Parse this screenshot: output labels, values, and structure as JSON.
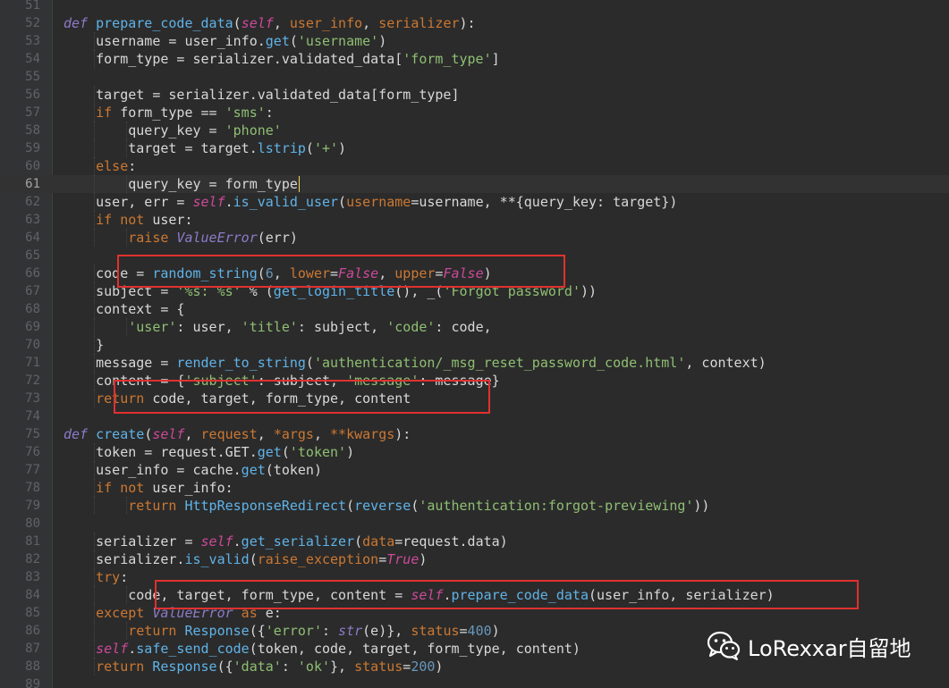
{
  "editor": {
    "language": "python",
    "current_line": 61,
    "colors": {
      "background": "#2b2b2b",
      "keyword": "#cc7832",
      "function": "#5fb3e8",
      "string": "#8fbf73",
      "number": "#6897bb",
      "self": "#cc4a9b",
      "def": "#8d7bc9",
      "highlight_box": "#e0312f"
    },
    "lines": [
      {
        "n": "51",
        "indent": 0,
        "tokens": []
      },
      {
        "n": "52",
        "indent": 1,
        "tokens": [
          [
            "def",
            "def"
          ],
          [
            "t",
            " "
          ],
          [
            "fn",
            "prepare_code_data"
          ],
          [
            "t",
            "("
          ],
          [
            "self",
            "self"
          ],
          [
            "t",
            ", "
          ],
          [
            "kwa",
            "user_info"
          ],
          [
            "t",
            ", "
          ],
          [
            "kwa",
            "serializer"
          ],
          [
            "t",
            "):"
          ]
        ]
      },
      {
        "n": "53",
        "indent": 2,
        "tokens": [
          [
            "t",
            "username = user_info."
          ],
          [
            "fn",
            "get"
          ],
          [
            "t",
            "("
          ],
          [
            "str",
            "'username'"
          ],
          [
            "t",
            ")"
          ]
        ]
      },
      {
        "n": "54",
        "indent": 2,
        "tokens": [
          [
            "t",
            "form_type = serializer.validated_data["
          ],
          [
            "str",
            "'form_type'"
          ],
          [
            "t",
            "]"
          ]
        ]
      },
      {
        "n": "55",
        "indent": 0,
        "tokens": []
      },
      {
        "n": "56",
        "indent": 2,
        "tokens": [
          [
            "t",
            "target = serializer.validated_data[form_type]"
          ]
        ]
      },
      {
        "n": "57",
        "indent": 2,
        "tokens": [
          [
            "kw",
            "if"
          ],
          [
            "t",
            " form_type == "
          ],
          [
            "str",
            "'sms'"
          ],
          [
            "t",
            ":"
          ]
        ]
      },
      {
        "n": "58",
        "indent": 3,
        "tokens": [
          [
            "t",
            "query_key = "
          ],
          [
            "str",
            "'phone'"
          ]
        ]
      },
      {
        "n": "59",
        "indent": 3,
        "tokens": [
          [
            "t",
            "target = target."
          ],
          [
            "fn",
            "lstrip"
          ],
          [
            "t",
            "("
          ],
          [
            "str",
            "'+'"
          ],
          [
            "t",
            ")"
          ]
        ]
      },
      {
        "n": "60",
        "indent": 2,
        "tokens": [
          [
            "kw",
            "else"
          ],
          [
            "t",
            ":"
          ]
        ]
      },
      {
        "n": "61",
        "indent": 3,
        "tokens": [
          [
            "t",
            "query_key = form_type"
          ]
        ]
      },
      {
        "n": "62",
        "indent": 2,
        "tokens": [
          [
            "t",
            "user, err = "
          ],
          [
            "self",
            "self"
          ],
          [
            "t",
            "."
          ],
          [
            "fn",
            "is_valid_user"
          ],
          [
            "t",
            "("
          ],
          [
            "kwa",
            "username"
          ],
          [
            "t",
            "=username, **{query_key: target})"
          ]
        ]
      },
      {
        "n": "63",
        "indent": 2,
        "tokens": [
          [
            "kw",
            "if not"
          ],
          [
            "t",
            " user:"
          ]
        ]
      },
      {
        "n": "64",
        "indent": 3,
        "tokens": [
          [
            "kw",
            "raise"
          ],
          [
            "t",
            " "
          ],
          [
            "cls",
            "ValueError"
          ],
          [
            "t",
            "(err)"
          ]
        ]
      },
      {
        "n": "65",
        "indent": 0,
        "tokens": []
      },
      {
        "n": "66",
        "indent": 2,
        "tokens": [
          [
            "t",
            "code = "
          ],
          [
            "fn",
            "random_string"
          ],
          [
            "t",
            "("
          ],
          [
            "num",
            "6"
          ],
          [
            "t",
            ", "
          ],
          [
            "kwa",
            "lower"
          ],
          [
            "t",
            "="
          ],
          [
            "bool",
            "False"
          ],
          [
            "t",
            ", "
          ],
          [
            "kwa",
            "upper"
          ],
          [
            "t",
            "="
          ],
          [
            "bool",
            "False"
          ],
          [
            "t",
            ")"
          ]
        ]
      },
      {
        "n": "67",
        "indent": 2,
        "tokens": [
          [
            "t",
            "subject = "
          ],
          [
            "str",
            "'%s: %s'"
          ],
          [
            "t",
            " % ("
          ],
          [
            "fn",
            "get_login_title"
          ],
          [
            "t",
            "(), _("
          ],
          [
            "str",
            "'Forgot password'"
          ],
          [
            "t",
            "))"
          ]
        ]
      },
      {
        "n": "68",
        "indent": 2,
        "tokens": [
          [
            "t",
            "context = {"
          ]
        ]
      },
      {
        "n": "69",
        "indent": 3,
        "tokens": [
          [
            "str",
            "'user'"
          ],
          [
            "t",
            ": user, "
          ],
          [
            "str",
            "'title'"
          ],
          [
            "t",
            ": subject, "
          ],
          [
            "str",
            "'code'"
          ],
          [
            "t",
            ": code,"
          ]
        ]
      },
      {
        "n": "70",
        "indent": 2,
        "tokens": [
          [
            "t",
            "}"
          ]
        ]
      },
      {
        "n": "71",
        "indent": 2,
        "tokens": [
          [
            "t",
            "message = "
          ],
          [
            "fn",
            "render_to_string"
          ],
          [
            "t",
            "("
          ],
          [
            "str",
            "'authentication/_msg_reset_password_code.html'"
          ],
          [
            "t",
            ", context)"
          ]
        ]
      },
      {
        "n": "72",
        "indent": 2,
        "tokens": [
          [
            "t",
            "content = {"
          ],
          [
            "str",
            "'subject'"
          ],
          [
            "t",
            ": subject, "
          ],
          [
            "str",
            "'message'"
          ],
          [
            "t",
            ": message}"
          ]
        ]
      },
      {
        "n": "73",
        "indent": 2,
        "tokens": [
          [
            "kw",
            "return"
          ],
          [
            "t",
            " code, target, form_type, content"
          ]
        ]
      },
      {
        "n": "74",
        "indent": 0,
        "tokens": []
      },
      {
        "n": "75",
        "indent": 1,
        "tokens": [
          [
            "def",
            "def"
          ],
          [
            "t",
            " "
          ],
          [
            "fn",
            "create"
          ],
          [
            "t",
            "("
          ],
          [
            "self",
            "self"
          ],
          [
            "t",
            ", "
          ],
          [
            "kwa",
            "request"
          ],
          [
            "t",
            ", "
          ],
          [
            "kwa",
            "*args"
          ],
          [
            "t",
            ", "
          ],
          [
            "kwa",
            "**kwargs"
          ],
          [
            "t",
            "):"
          ]
        ]
      },
      {
        "n": "76",
        "indent": 2,
        "tokens": [
          [
            "t",
            "token = request.GET."
          ],
          [
            "fn",
            "get"
          ],
          [
            "t",
            "("
          ],
          [
            "str",
            "'token'"
          ],
          [
            "t",
            ")"
          ]
        ]
      },
      {
        "n": "77",
        "indent": 2,
        "tokens": [
          [
            "t",
            "user_info = cache."
          ],
          [
            "fn",
            "get"
          ],
          [
            "t",
            "(token)"
          ]
        ]
      },
      {
        "n": "78",
        "indent": 2,
        "tokens": [
          [
            "kw",
            "if not"
          ],
          [
            "t",
            " user_info:"
          ]
        ]
      },
      {
        "n": "79",
        "indent": 3,
        "tokens": [
          [
            "kw",
            "return"
          ],
          [
            "t",
            " "
          ],
          [
            "fn",
            "HttpResponseRedirect"
          ],
          [
            "t",
            "("
          ],
          [
            "fn",
            "reverse"
          ],
          [
            "t",
            "("
          ],
          [
            "str",
            "'authentication:forgot-previewing'"
          ],
          [
            "t",
            "))"
          ]
        ]
      },
      {
        "n": "80",
        "indent": 0,
        "tokens": []
      },
      {
        "n": "81",
        "indent": 2,
        "tokens": [
          [
            "t",
            "serializer = "
          ],
          [
            "self",
            "self"
          ],
          [
            "t",
            "."
          ],
          [
            "fn",
            "get_serializer"
          ],
          [
            "t",
            "("
          ],
          [
            "kwa",
            "data"
          ],
          [
            "t",
            "=request.data)"
          ]
        ]
      },
      {
        "n": "82",
        "indent": 2,
        "tokens": [
          [
            "t",
            "serializer."
          ],
          [
            "fn",
            "is_valid"
          ],
          [
            "t",
            "("
          ],
          [
            "kwa",
            "raise_exception"
          ],
          [
            "t",
            "="
          ],
          [
            "bool",
            "True"
          ],
          [
            "t",
            ")"
          ]
        ]
      },
      {
        "n": "83",
        "indent": 2,
        "tokens": [
          [
            "kw",
            "try"
          ],
          [
            "t",
            ":"
          ]
        ]
      },
      {
        "n": "84",
        "indent": 3,
        "tokens": [
          [
            "t",
            "code, target, form_type, content = "
          ],
          [
            "self",
            "self"
          ],
          [
            "t",
            "."
          ],
          [
            "fn",
            "prepare_code_data"
          ],
          [
            "t",
            "(user_info, serializer)"
          ]
        ]
      },
      {
        "n": "85",
        "indent": 2,
        "tokens": [
          [
            "kw",
            "except"
          ],
          [
            "t",
            " "
          ],
          [
            "cls",
            "ValueError"
          ],
          [
            "t",
            " "
          ],
          [
            "kw",
            "as"
          ],
          [
            "t",
            " e:"
          ]
        ]
      },
      {
        "n": "86",
        "indent": 3,
        "tokens": [
          [
            "kw",
            "return"
          ],
          [
            "t",
            " "
          ],
          [
            "fn",
            "Response"
          ],
          [
            "t",
            "({"
          ],
          [
            "str",
            "'error'"
          ],
          [
            "t",
            ": "
          ],
          [
            "cls",
            "str"
          ],
          [
            "t",
            "(e)}, "
          ],
          [
            "kwa",
            "status"
          ],
          [
            "t",
            "="
          ],
          [
            "num",
            "400"
          ],
          [
            "t",
            ")"
          ]
        ]
      },
      {
        "n": "87",
        "indent": 2,
        "tokens": [
          [
            "self",
            "self"
          ],
          [
            "t",
            "."
          ],
          [
            "fn",
            "safe_send_code"
          ],
          [
            "t",
            "(token, code, target, form_type, content)"
          ]
        ]
      },
      {
        "n": "88",
        "indent": 2,
        "tokens": [
          [
            "kw",
            "return"
          ],
          [
            "t",
            " "
          ],
          [
            "fn",
            "Response"
          ],
          [
            "t",
            "({"
          ],
          [
            "str",
            "'data'"
          ],
          [
            "t",
            ": "
          ],
          [
            "str",
            "'ok'"
          ],
          [
            "t",
            "}, "
          ],
          [
            "kwa",
            "status"
          ],
          [
            "t",
            "="
          ],
          [
            "num",
            "200"
          ],
          [
            "t",
            ")"
          ]
        ]
      },
      {
        "n": "89",
        "indent": 0,
        "tokens": []
      }
    ]
  },
  "watermark": {
    "icon": "wechat-icon",
    "text": "LoRexxar自留地"
  }
}
